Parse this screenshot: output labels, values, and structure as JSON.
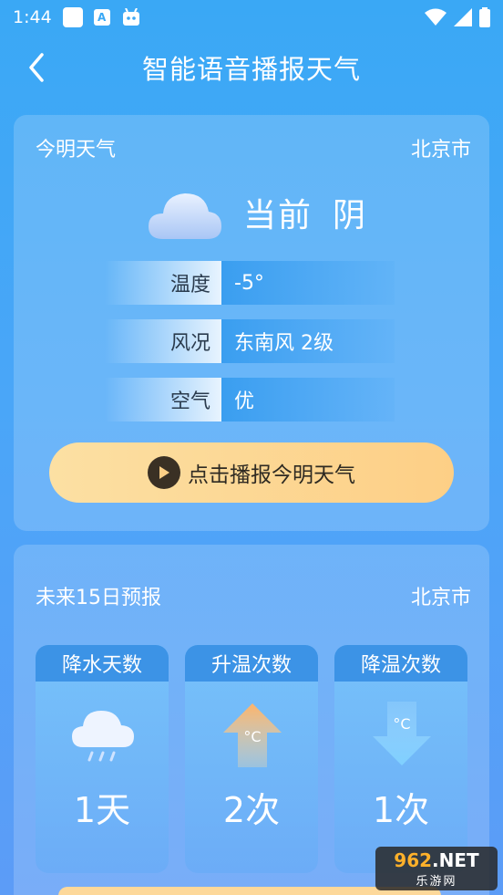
{
  "status_bar": {
    "time": "1:44"
  },
  "header": {
    "title": "智能语音播报天气"
  },
  "today_card": {
    "title": "今明天气",
    "city": "北京市",
    "current_label": "当前",
    "current_condition": "阴",
    "rows": [
      {
        "label": "温度",
        "value": "-5°"
      },
      {
        "label": "风况",
        "value": "东南风 2级"
      },
      {
        "label": "空气",
        "value": "优"
      }
    ],
    "play_button": "点击播报今明天气"
  },
  "forecast_card": {
    "title": "未来15日预报",
    "city": "北京市",
    "stats": [
      {
        "title": "降水天数",
        "value": "1天",
        "icon": "rain-cloud-icon"
      },
      {
        "title": "升温次数",
        "value": "2次",
        "icon": "temp-up-arrow-icon",
        "icon_text": "°C"
      },
      {
        "title": "降温次数",
        "value": "1次",
        "icon": "temp-down-arrow-icon",
        "icon_text": "°C"
      }
    ]
  },
  "watermark": {
    "brand_a": "962",
    "brand_b": ".NET",
    "sub": "乐游网"
  },
  "colors": {
    "accent_orange": "#fdcf86",
    "sky_blue": "#3aa8f5"
  }
}
